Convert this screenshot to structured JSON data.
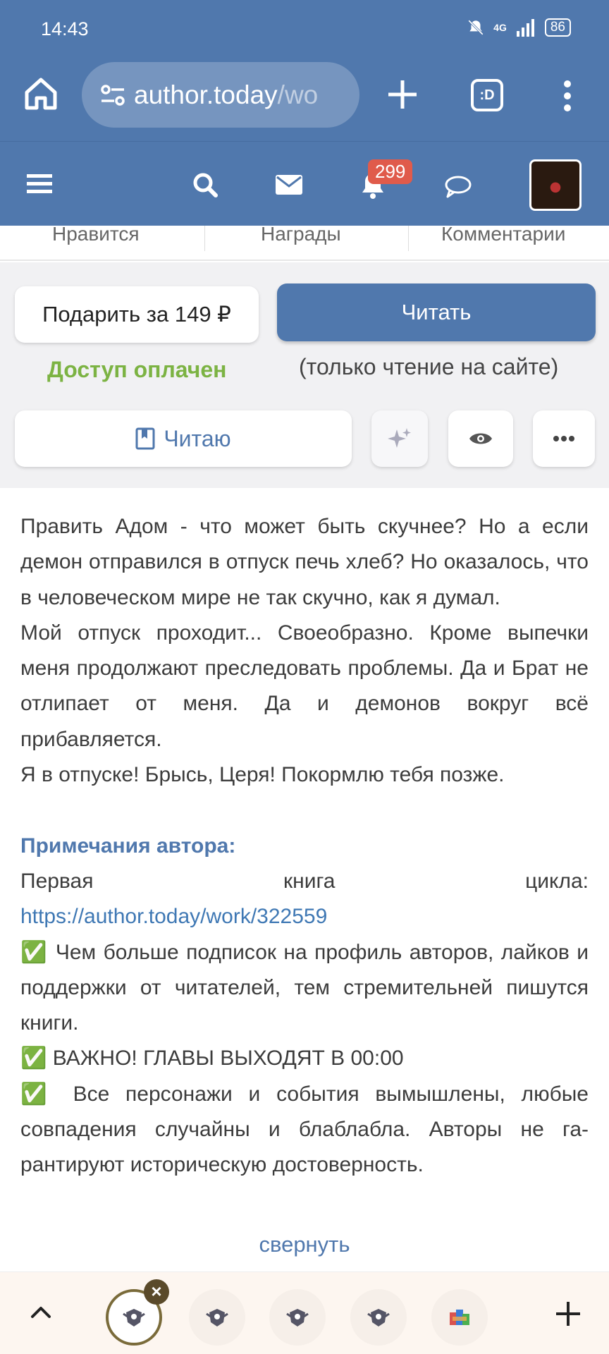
{
  "status_bar": {
    "time": "14:43",
    "network": "4G",
    "battery": "86"
  },
  "browser": {
    "url_host": "author.today",
    "url_path": "/wo",
    "tabs_label": ":D"
  },
  "site_nav": {
    "notifications_count": "299"
  },
  "stats": {
    "likes_label": "Нравится",
    "awards_label": "Награды",
    "comments_label": "Комментарии"
  },
  "actions": {
    "gift_label": "Подарить за 149 ₽",
    "read_label": "Читать",
    "paid_label": "Доступ оплачен",
    "read_note": "(только чтение на сайте)",
    "reading_label": "Читаю"
  },
  "description": {
    "paragraphs": [
      "Править Адом - что может быть скучнее? Но а если демон отправился в отпуск печь хлеб? Но оказалось, что в человеческом мире не так скучно, как я думал.",
      "Мой отпуск проходит... Своеобразно. Кроме вы­печки меня продолжают преследовать проблемы. Да и Брат не отлипает от меня. Да и демонов во­круг всё прибавляется.",
      "Я в отпуске! Брысь, Церя! Покормлю тебя позже."
    ],
    "notes_title": "Примечания автора:",
    "first_book_label": "Первая книга цикла:",
    "first_book_link": "https://author.today/work/322559",
    "notes": [
      "✅  Чем больше подписок на профиль авторов, лайков и поддержки от читателей, тем стреми­тельней пишутся книги.",
      "✅ ВАЖНО! ГЛАВЫ ВЫХОДЯТ В 00:00",
      "✅ Все персонажи и события вымышлены, любые совпадения случайны и блаблабла. Авторы не га­рантируют историческую достоверность."
    ],
    "collapse_label": "свернуть"
  },
  "colors": {
    "brand": "#5078ad",
    "paid": "#7cb343",
    "badge": "#e05b4b"
  }
}
